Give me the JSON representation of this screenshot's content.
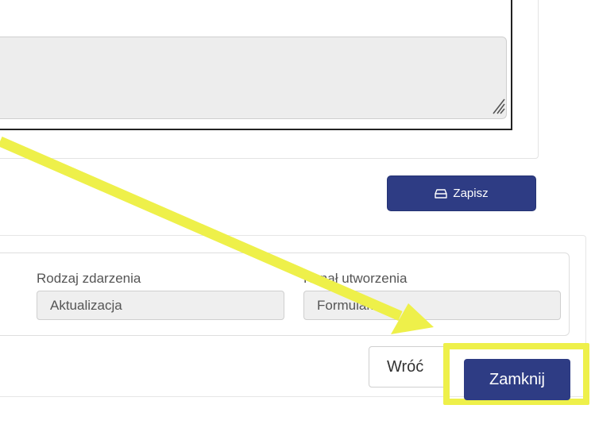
{
  "editor": {
    "textarea_value": ""
  },
  "toolbar": {
    "save_label": "Zapisz",
    "save_icon": "save-icon"
  },
  "details": {
    "event_type": {
      "label": "Rodzaj zdarzenia",
      "value": "Aktualizacja"
    },
    "creation_channel": {
      "label": "Kanał utworzenia",
      "value": "Formularz"
    }
  },
  "footer": {
    "back_label": "Wróć",
    "close_label": "Zamknij"
  },
  "annotation": {
    "arrow_color": "#eef04a",
    "highlight_color": "#eef04a"
  },
  "colors": {
    "primary": "#2e3c84"
  }
}
